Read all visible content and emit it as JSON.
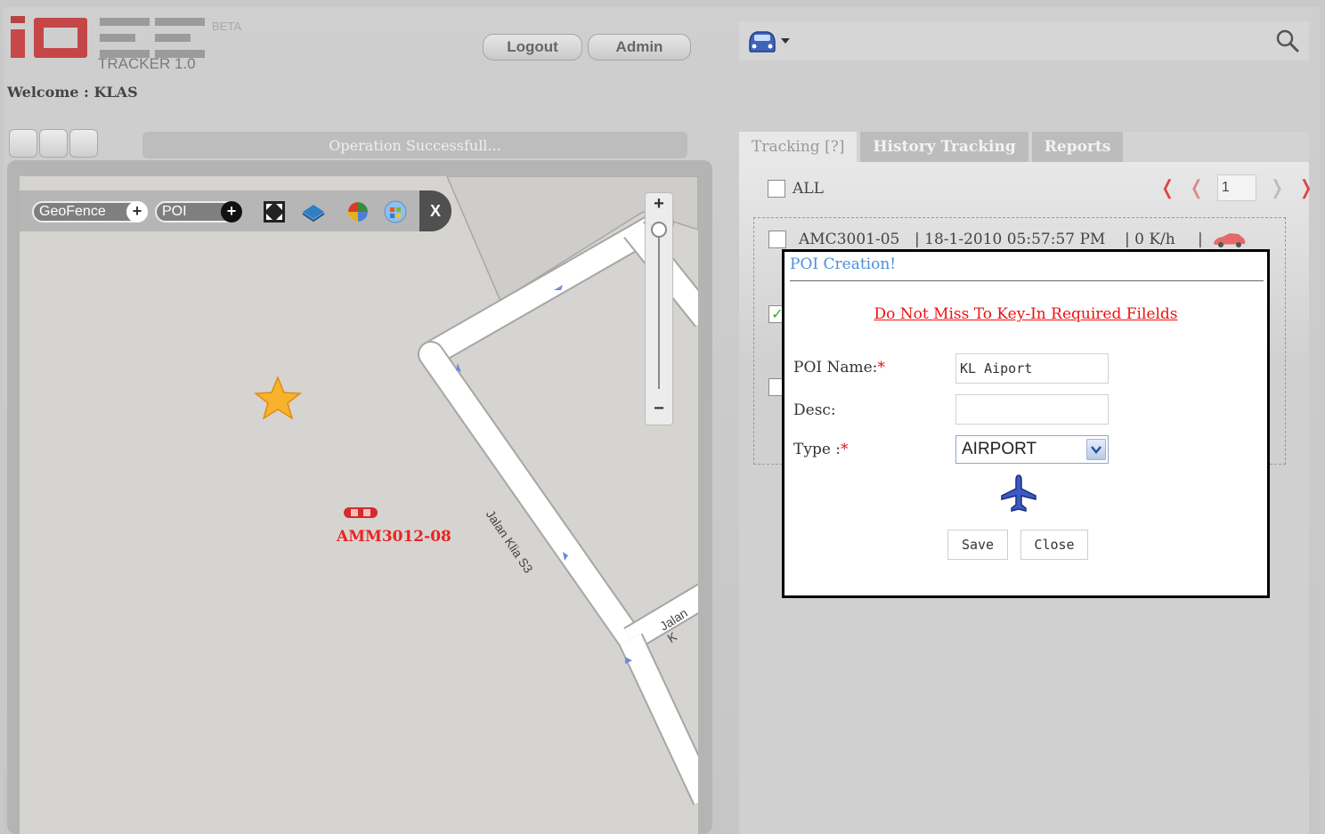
{
  "header": {
    "beta_label": "BETA",
    "version": "TRACKER 1.0",
    "welcome": "Welcome : KLAS",
    "logout_label": "Logout",
    "admin_label": "Admin"
  },
  "search": {
    "icon": "search-icon",
    "vehicle_icon": "car-icon"
  },
  "status": {
    "message": "Operation Successfull..."
  },
  "map": {
    "geofence_label": "GeoFence",
    "poi_label": "POI",
    "close_label": "X",
    "zoom_in": "+",
    "zoom_out": "−",
    "vehicle_label": "AMM3012-08",
    "road1": "Jalan Klia S3",
    "road2": "Jalan K"
  },
  "tabs": [
    {
      "label": "Tracking [?]"
    },
    {
      "label": "History Tracking"
    },
    {
      "label": "Reports"
    }
  ],
  "list": {
    "all_label": "ALL",
    "page": "1",
    "row1": {
      "id": "AMC3001-05",
      "time": "| 18-1-2010 05:57:57 PM",
      "speed": "| 0 K/h",
      "sep": "|"
    }
  },
  "dialog": {
    "title": "POI Creation!",
    "warning": "Do Not Miss To Key-In Required Filelds",
    "name_label": "POI Name:",
    "name_value": "KL Aiport",
    "desc_label": "Desc:",
    "desc_value": "",
    "type_label": "Type :",
    "type_value": "AIRPORT",
    "required_mark": "*",
    "type_icon": "airplane-icon",
    "save_label": "Save",
    "close_label": "Close"
  },
  "colors": {
    "accent_red": "#e11111",
    "title_blue": "#4a90d9",
    "logo_red": "#c44646"
  }
}
